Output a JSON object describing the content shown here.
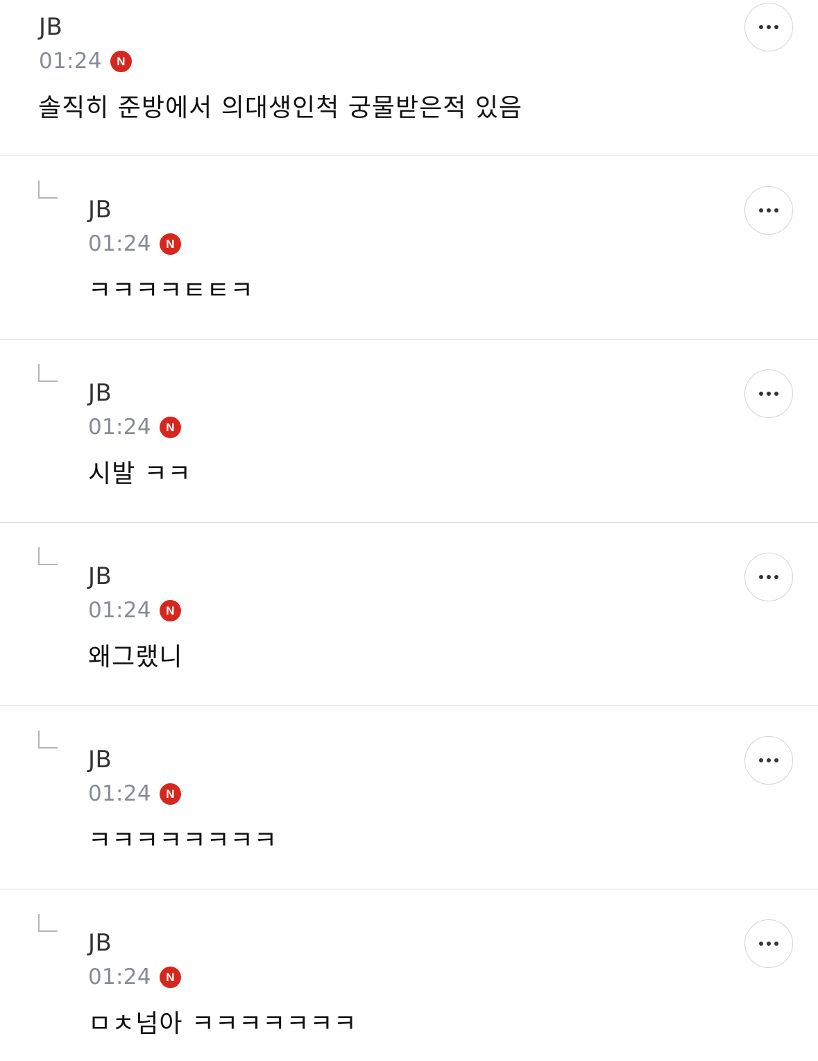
{
  "comments": [
    {
      "author": "JB",
      "time": "01:24",
      "badge": "N",
      "text": "솔직히 준방에서 의대생인척 궁물받은적 있음"
    },
    {
      "author": "JB",
      "time": "01:24",
      "badge": "N",
      "text": "ㅋㅋㅋㅋㅌㅌㅋ"
    },
    {
      "author": "JB",
      "time": "01:24",
      "badge": "N",
      "text": "시발 ㅋㅋ"
    },
    {
      "author": "JB",
      "time": "01:24",
      "badge": "N",
      "text": "왜그랬니"
    },
    {
      "author": "JB",
      "time": "01:24",
      "badge": "N",
      "text": "ㅋㅋㅋㅋㅋㅋㅋㅋ"
    },
    {
      "author": "JB",
      "time": "01:24",
      "badge": "N",
      "text": "ㅁㅊ넘아 ㅋㅋㅋㅋㅋㅋㅋ"
    }
  ],
  "colors": {
    "badge": "#d6271f",
    "time": "#868b94",
    "divider": "#dcdcdc"
  },
  "icons": {
    "more": "more-horizontal-icon",
    "reply": "reply-arrow-icon"
  }
}
